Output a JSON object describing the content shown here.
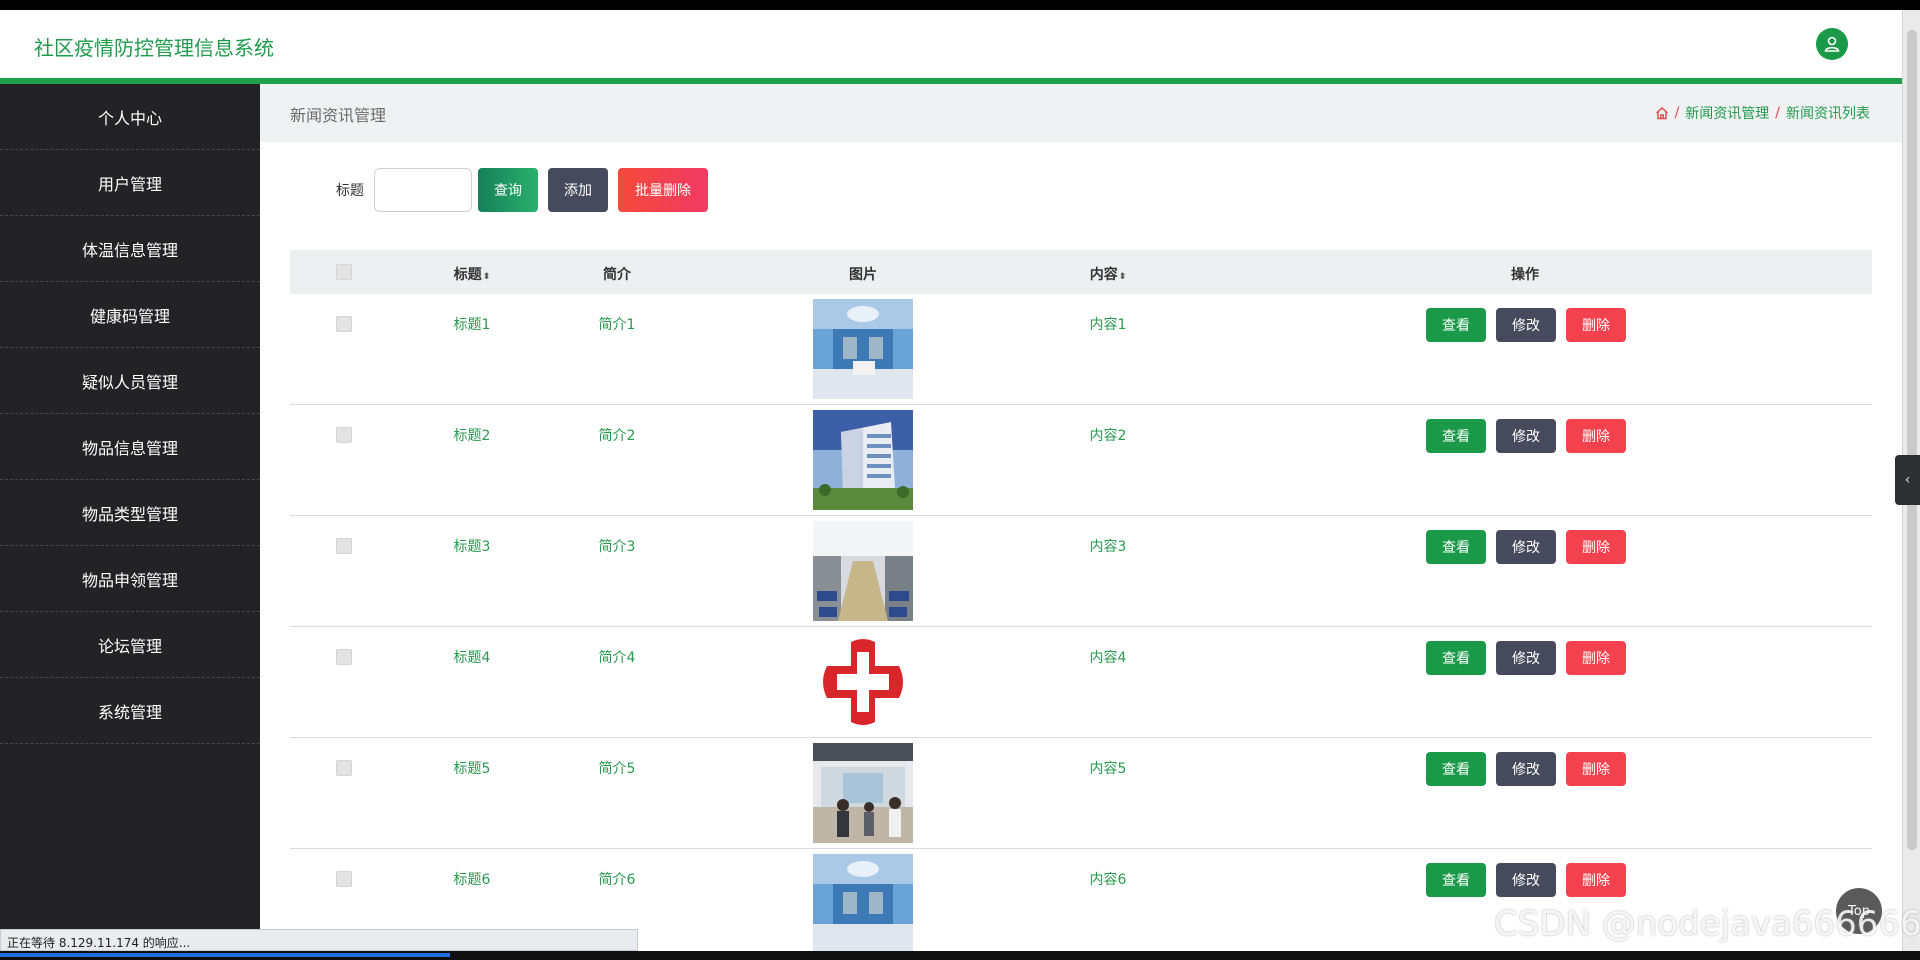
{
  "app": {
    "title": "社区疫情防控管理信息系统"
  },
  "header": {
    "avatar_icon": "user-icon"
  },
  "sidebar": {
    "items": [
      {
        "label": "个人中心"
      },
      {
        "label": "用户管理"
      },
      {
        "label": "体温信息管理"
      },
      {
        "label": "健康码管理"
      },
      {
        "label": "疑似人员管理"
      },
      {
        "label": "物品信息管理"
      },
      {
        "label": "物品类型管理"
      },
      {
        "label": "物品申领管理"
      },
      {
        "label": "论坛管理"
      },
      {
        "label": "系统管理"
      }
    ]
  },
  "page": {
    "title": "新闻资讯管理",
    "breadcrumb": {
      "home_icon": "home-icon",
      "level1": "新闻资讯管理",
      "level2": "新闻资讯列表"
    }
  },
  "search": {
    "label": "标题",
    "value": "",
    "query_label": "查询",
    "add_label": "添加",
    "batch_delete_label": "批量删除"
  },
  "table": {
    "headers": {
      "title": "标题",
      "summary": "简介",
      "image": "图片",
      "content": "内容",
      "actions": "操作"
    },
    "sort_icon": "sort-icon",
    "action_labels": {
      "view": "查看",
      "edit": "修改",
      "delete": "删除"
    },
    "rows": [
      {
        "title": "标题1",
        "summary": "简介1",
        "content": "内容1",
        "image": "hospital-room-image"
      },
      {
        "title": "标题2",
        "summary": "简介2",
        "content": "内容2",
        "image": "hospital-building-image"
      },
      {
        "title": "标题3",
        "summary": "简介3",
        "content": "内容3",
        "image": "waiting-hall-image"
      },
      {
        "title": "标题4",
        "summary": "简介4",
        "content": "内容4",
        "image": "red-cross-image"
      },
      {
        "title": "标题5",
        "summary": "简介5",
        "content": "内容5",
        "image": "clinic-lobby-image"
      },
      {
        "title": "标题6",
        "summary": "简介6",
        "content": "内容6",
        "image": "hospital-room-image"
      }
    ]
  },
  "misc": {
    "top_label": "Top",
    "status_text": "正在等待 8.129.11.174 的响应...",
    "watermark": "CSDN @nodejava666666"
  },
  "colors": {
    "accent": "#1fa04a",
    "sidebar_bg": "#232325",
    "danger": "#f3424e",
    "dark_button": "#464a5c"
  }
}
